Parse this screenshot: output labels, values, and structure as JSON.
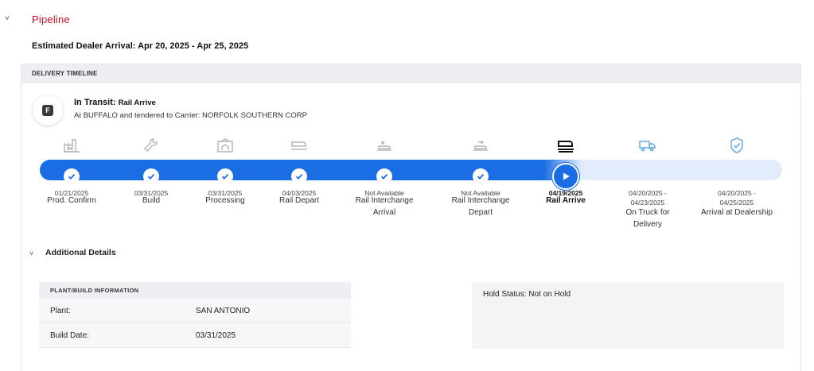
{
  "pipeline": {
    "title": "Pipeline"
  },
  "eta": {
    "text": "Estimated Dealer Arrival: Apr 20, 2025 - Apr 25, 2025"
  },
  "timeline": {
    "header": "DELIVERY TIMELINE",
    "badge_letter": "F",
    "status_label": "In Transit:",
    "status_value": "Rail Arrive",
    "location": "At BUFFALO and tendered to Carrier: NORFOLK SOUTHERN CORP",
    "progress_fraction": 0.73,
    "colors": {
      "accent": "#1b6de3",
      "track": "#e2ecfb",
      "completed_icon": "#b5b5b5",
      "pending_icon": "#5aa6e0"
    },
    "stages": [
      {
        "icon": "factory-icon",
        "date": "01/21/2025",
        "label": "Prod. Confirm",
        "state": "done"
      },
      {
        "icon": "wrench-icon",
        "date": "03/31/2025",
        "label": "Build",
        "state": "done"
      },
      {
        "icon": "processing-icon",
        "date": "03/31/2025",
        "label": "Processing",
        "state": "done"
      },
      {
        "icon": "rail-depart-icon",
        "date": "04/03/2025",
        "label": "Rail Depart",
        "state": "done"
      },
      {
        "icon": "rail-interchange-arrival-icon",
        "date": "Not Available",
        "label": "Rail Interchange Arrival",
        "state": "done"
      },
      {
        "icon": "rail-interchange-depart-icon",
        "date": "Not Available",
        "label": "Rail Interchange Depart",
        "state": "done"
      },
      {
        "icon": "rail-arrive-icon",
        "date": "04/19/2025",
        "label": "Rail Arrive",
        "state": "current"
      },
      {
        "icon": "truck-icon",
        "date": "04/20/2025 - 04/23/2025",
        "label": "On Truck for Delivery",
        "state": "pending"
      },
      {
        "icon": "shield-check-icon",
        "date": "04/20/2025 - 04/25/2025",
        "label": "Arrival at Dealership",
        "state": "pending"
      }
    ]
  },
  "additional": {
    "title": "Additional Details",
    "plant_card": {
      "header": "PLANT/BUILD INFORMATION",
      "rows": [
        {
          "key": "Plant:",
          "value": "SAN ANTONIO"
        },
        {
          "key": "Build Date:",
          "value": "03/31/2025"
        }
      ]
    },
    "hold_status": "Hold Status: Not on Hold"
  }
}
